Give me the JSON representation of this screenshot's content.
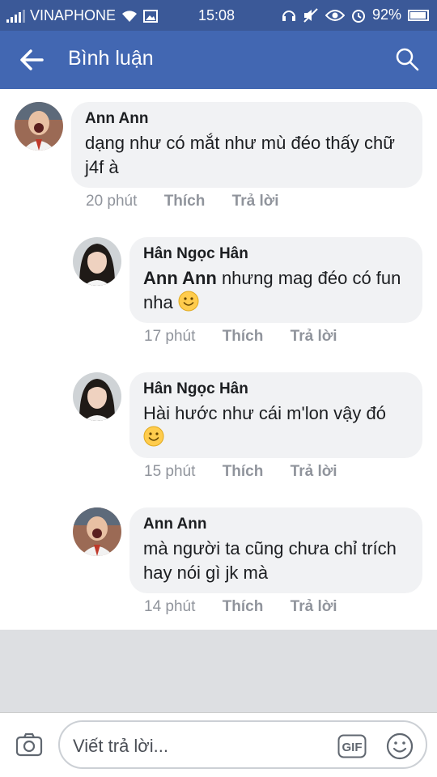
{
  "status_bar": {
    "carrier": "VINAPHONE",
    "time": "15:08",
    "battery": "92%"
  },
  "header": {
    "title": "Bình luận"
  },
  "comments": [
    {
      "author": "Ann Ann",
      "text": "dạng như có mắt như mù đéo thấy chữ j4f à",
      "time": "20 phút",
      "like_label": "Thích",
      "reply_label": "Trả lời"
    },
    {
      "author": "Hân Ngọc Hân",
      "mention": "Ann Ann",
      "text": " nhưng mag đéo có fun nha",
      "time": "17 phút",
      "like_label": "Thích",
      "reply_label": "Trả lời"
    },
    {
      "author": "Hân Ngọc Hân",
      "text": "Hài hước như cái m'lon vậy đó",
      "time": "15 phút",
      "like_label": "Thích",
      "reply_label": "Trả lời"
    },
    {
      "author": "Ann Ann",
      "text": "mà người ta cũng chưa chỉ trích hay nói gì jk mà",
      "time": "14 phút",
      "like_label": "Thích",
      "reply_label": "Trả lời"
    }
  ],
  "composer": {
    "placeholder": "Viết trả lời...",
    "gif_label": "GIF"
  },
  "colors": {
    "status_bar": "#3b5998",
    "header": "#4267b2",
    "bubble": "#f1f2f4",
    "meta": "#90949c",
    "background": "#dddfe2"
  },
  "icons": [
    "back-arrow-icon",
    "search-icon",
    "camera-icon",
    "gif-icon",
    "emoji-icon",
    "smiley-emoji-icon"
  ]
}
